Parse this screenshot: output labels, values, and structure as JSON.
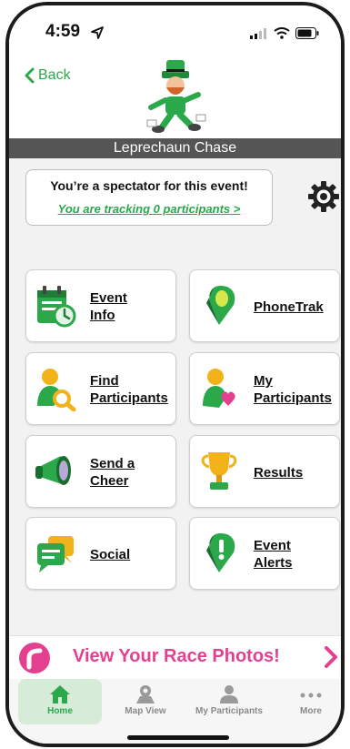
{
  "status_bar": {
    "time": "4:59"
  },
  "header": {
    "back_label": "Back"
  },
  "event": {
    "name": "Leprechaun Chase"
  },
  "spectator": {
    "title": "You’re a spectator for this event!",
    "tracking_link": "You are tracking 0 participants >"
  },
  "tiles": [
    {
      "label": "Event\nInfo",
      "icon": "calendar-clock-icon"
    },
    {
      "label": "PhoneTrak",
      "icon": "phonetrak-pin-icon"
    },
    {
      "label": "Find\nParticipants",
      "icon": "find-participant-icon"
    },
    {
      "label": "My\nParticipants",
      "icon": "my-participants-icon"
    },
    {
      "label": "Send a\nCheer",
      "icon": "megaphone-icon"
    },
    {
      "label": "Results",
      "icon": "trophy-icon"
    },
    {
      "label": "Social",
      "icon": "chat-bubbles-icon"
    },
    {
      "label": "Event\nAlerts",
      "icon": "alert-pin-icon"
    }
  ],
  "photos_banner": {
    "text": "View Your Race Photos!"
  },
  "tab_bar": {
    "tabs": [
      {
        "label": "Home",
        "icon": "home-icon",
        "active": true
      },
      {
        "label": "Map View",
        "icon": "map-pin-icon",
        "active": false
      },
      {
        "label": "My Participants",
        "icon": "person-icon",
        "active": false
      },
      {
        "label": "More",
        "icon": "more-dots-icon",
        "active": false
      }
    ]
  },
  "colors": {
    "accent_green": "#2aa84a",
    "event_bar": "#555555",
    "photos_pink": "#e3408f",
    "active_tab_bg": "#d6ecd9"
  }
}
